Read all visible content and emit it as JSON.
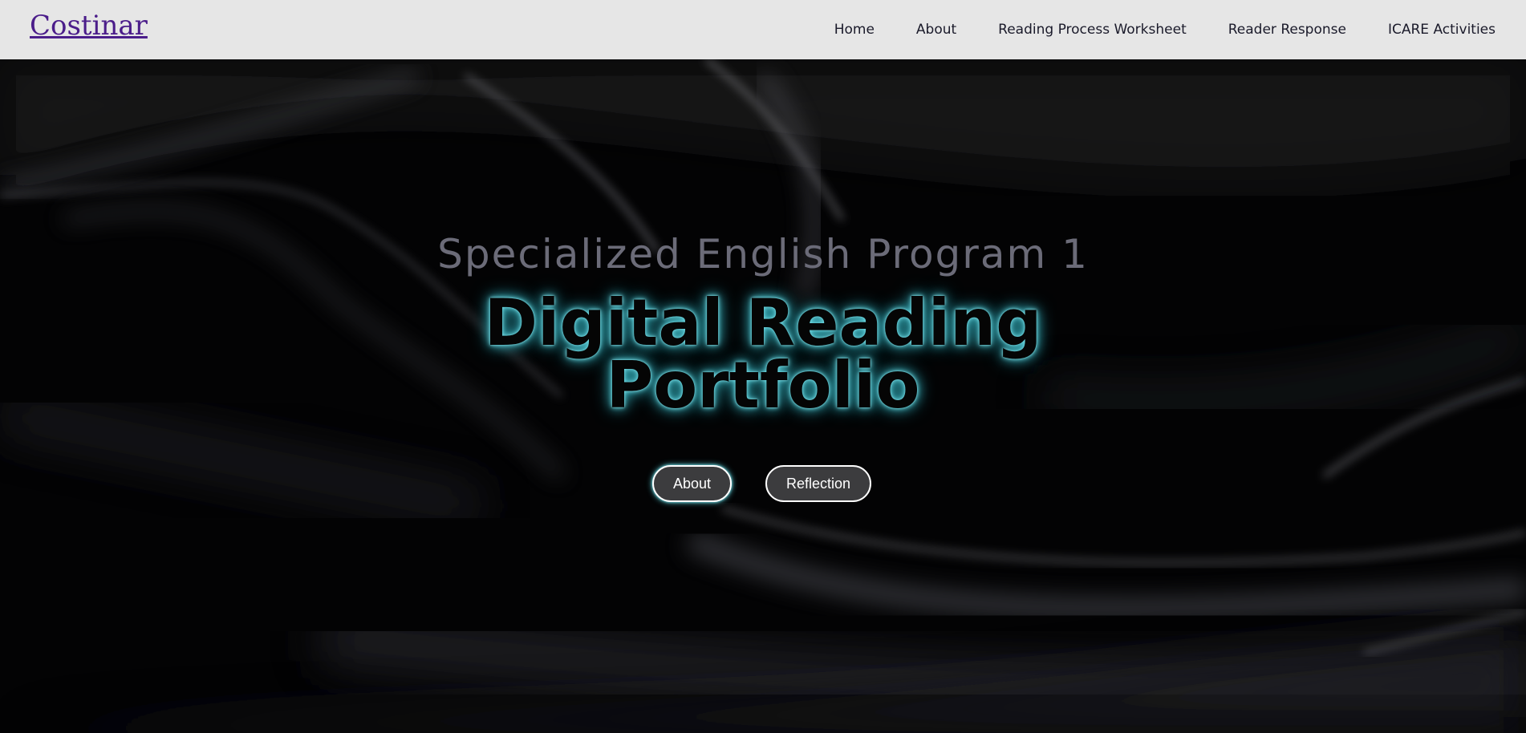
{
  "navbar": {
    "brand": "Costinar",
    "links": [
      {
        "label": "Home"
      },
      {
        "label": "About"
      },
      {
        "label": "Reading Process Worksheet"
      },
      {
        "label": "Reader Response"
      },
      {
        "label": "ICARE Activities"
      }
    ]
  },
  "hero": {
    "subtitle": "Specialized English Program 1",
    "title_line1": "Digital Reading",
    "title_line2": "Portfolio",
    "buttons": {
      "about_label": "About",
      "reflection_label": "Reflection"
    }
  },
  "colors": {
    "navbar_bg": "#e6e6e6",
    "brand": "#4b1d8a",
    "glow": "#3bb4c0",
    "button_bg": "#3c3c3e"
  }
}
